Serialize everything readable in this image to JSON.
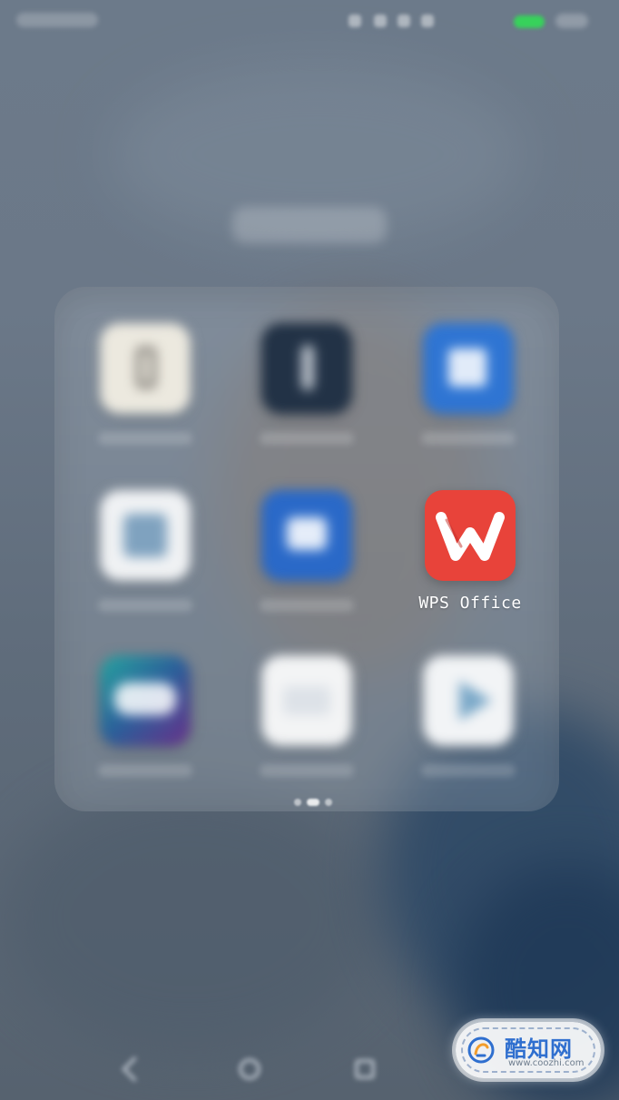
{
  "folder": {
    "apps": [
      {
        "name": "",
        "style": "beige"
      },
      {
        "name": "",
        "style": "navy"
      },
      {
        "name": "",
        "style": "blue"
      },
      {
        "name": "",
        "style": "white-blue"
      },
      {
        "name": "",
        "style": "blue2"
      },
      {
        "name": "WPS Office",
        "style": "wps"
      },
      {
        "name": "",
        "style": "game"
      },
      {
        "name": "",
        "style": "white-doc"
      },
      {
        "name": "",
        "style": "white-play"
      }
    ]
  },
  "watermark": {
    "brand": "酷知网",
    "url": "www.coozhi.com"
  },
  "colors": {
    "wps_red": "#e8433a",
    "battery_green": "#37d25b",
    "watermark_blue": "#2f6fcf"
  }
}
